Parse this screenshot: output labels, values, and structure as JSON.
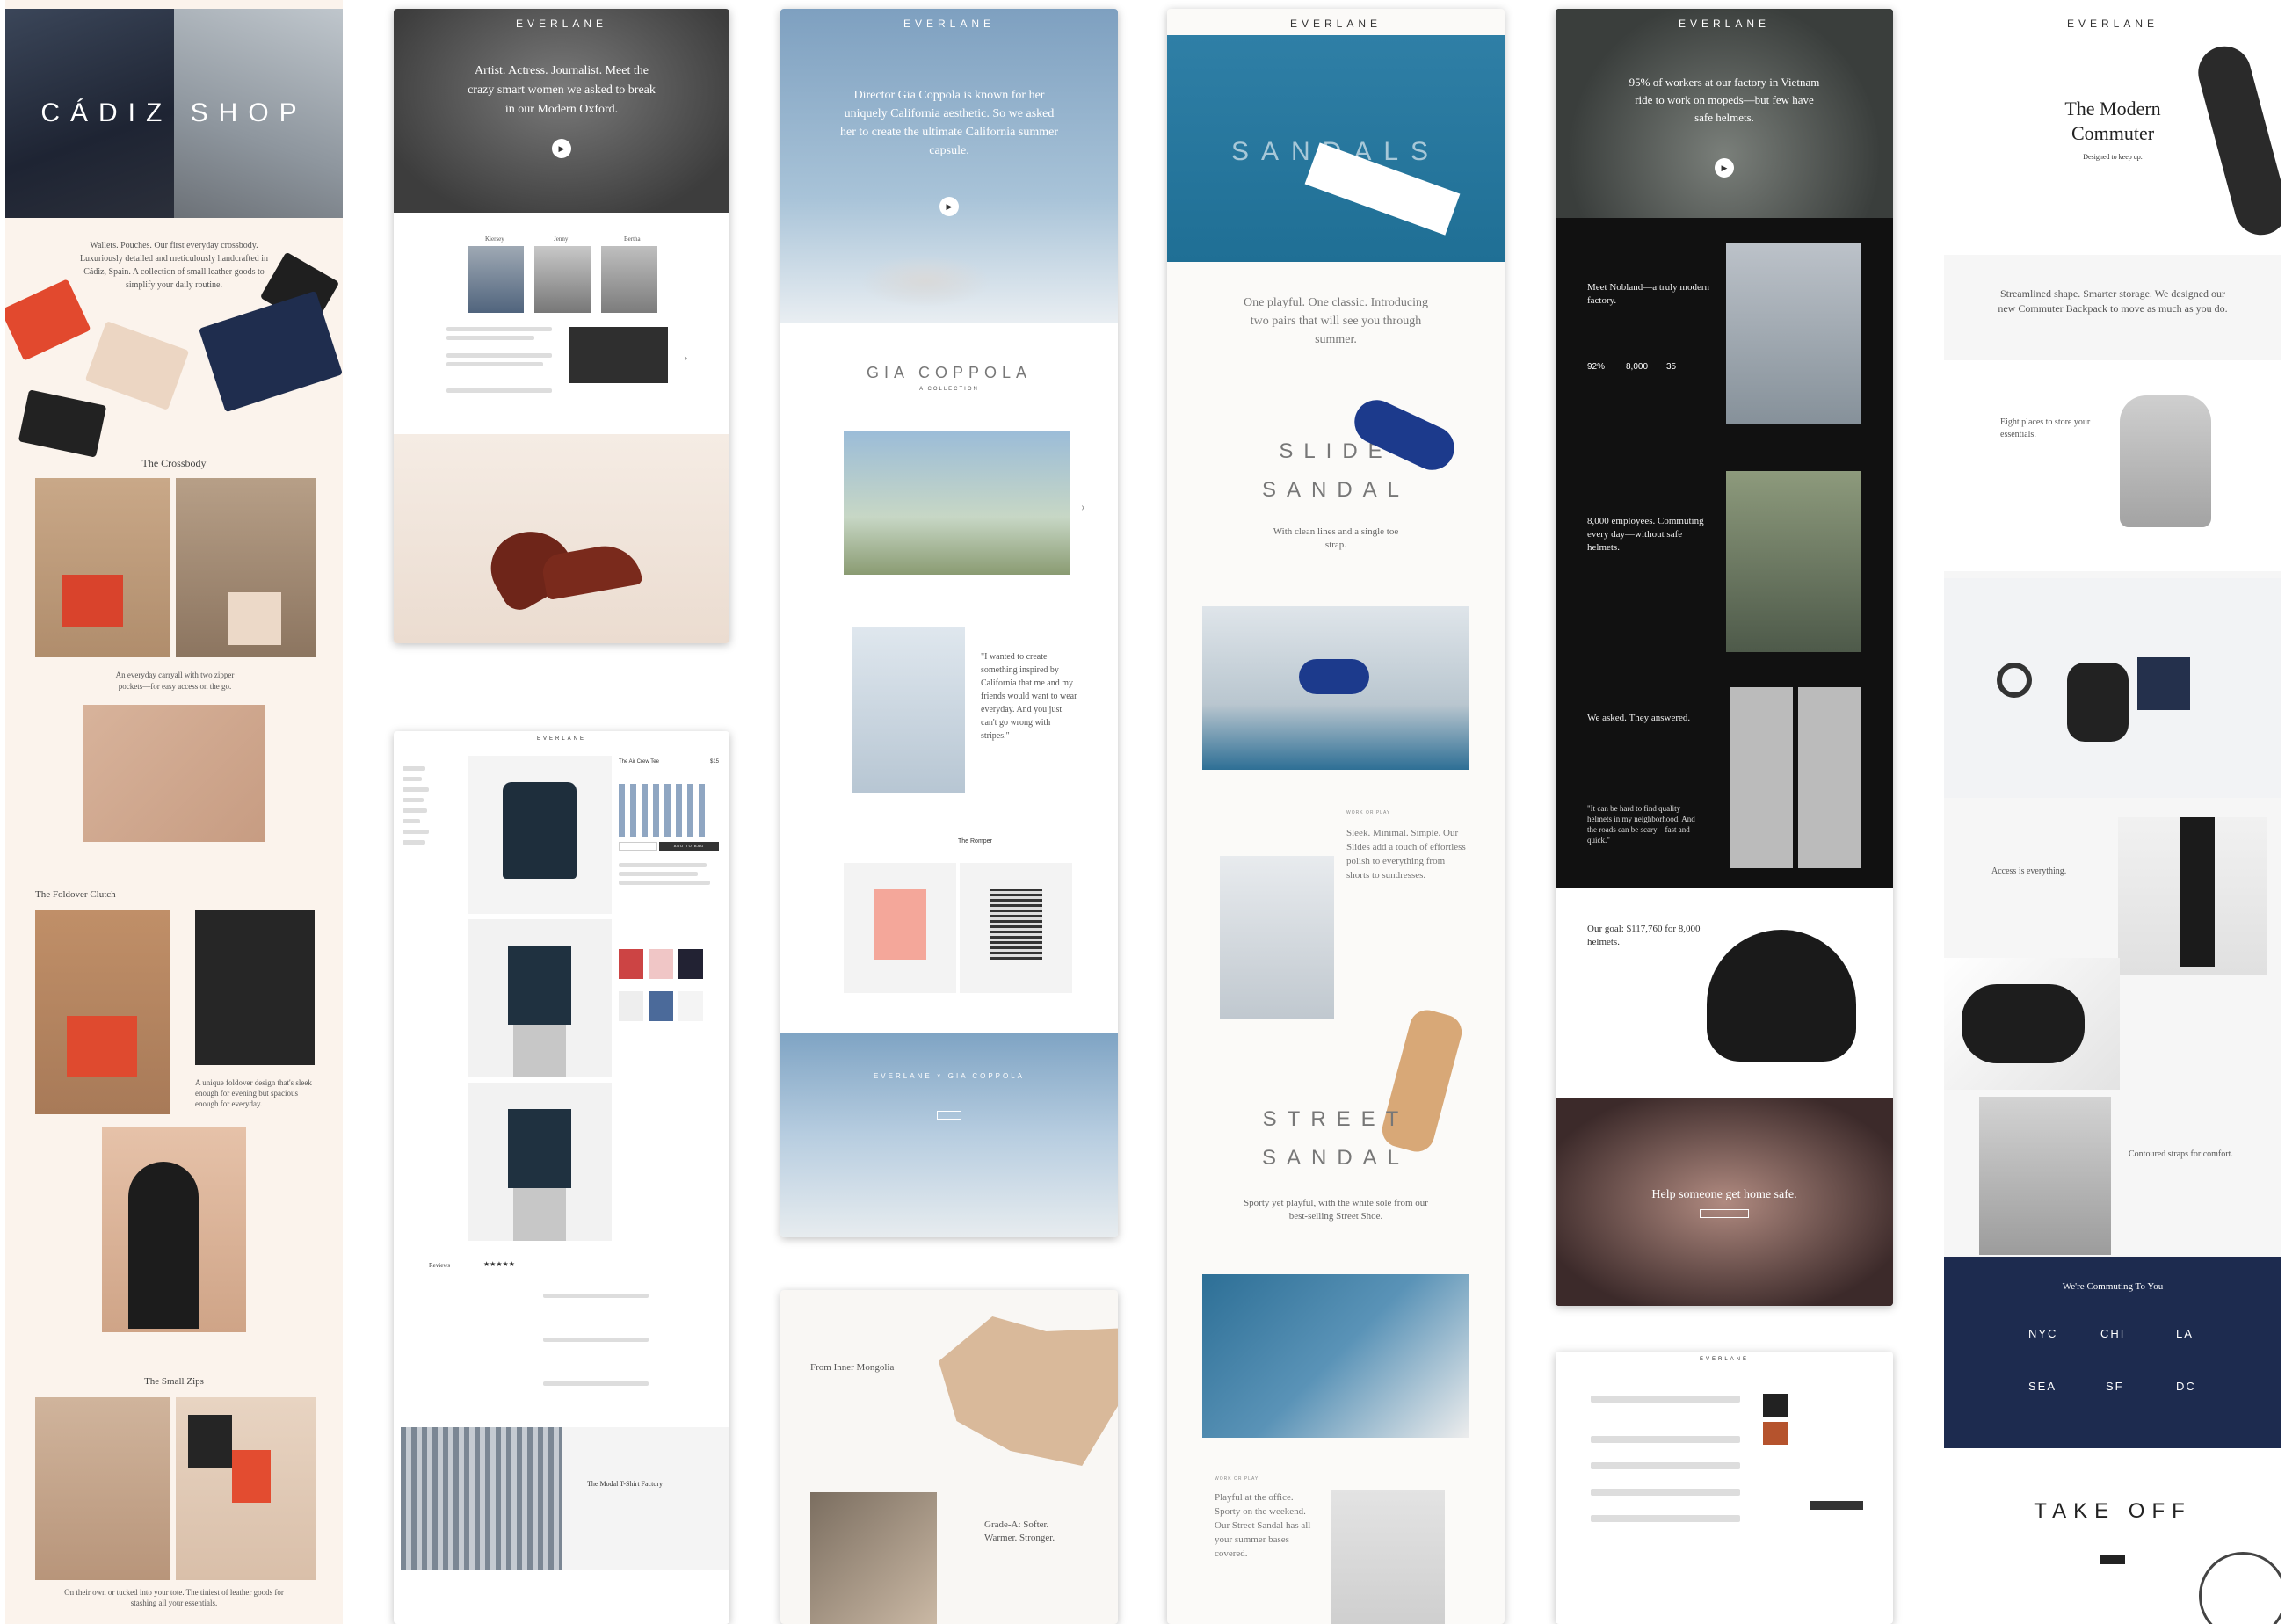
{
  "col1": {
    "hero_title": "CÁDIZ SHOP",
    "intro": "Wallets. Pouches. Our first everyday crossbody. Luxuriously detailed and meticulously handcrafted in Cádiz, Spain. A collection of small leather goods to simplify your daily routine.",
    "crossbody_title": "The Crossbody",
    "crossbody_caption": "An everyday carryall with two zipper pockets—for easy access on the go.",
    "clutch_title": "The Foldover Clutch",
    "clutch_caption": "A unique foldover design that's sleek enough for evening but spacious enough for everyday.",
    "zips_title": "The Small Zips",
    "zips_caption": "On their own or tucked into your tote. The tiniest of leather goods for stashing all your essentials."
  },
  "col2": {
    "logo": "EVERLANE",
    "hero_text": "Artist. Actress. Journalist. Meet the crazy smart women we asked to break in our Modern Oxford.",
    "names": [
      "Kiersey",
      "Jenny",
      "Bertha"
    ],
    "product_title": "The Air Crew Tee",
    "price": "$15",
    "add_to_bag": "ADD TO BAG",
    "reviews_title": "Reviews",
    "factory_title": "The Modal T-Shirt Factory"
  },
  "col3": {
    "logo": "EVERLANE",
    "hero_text": "Director Gia Coppola is known for her uniquely California aesthetic. So we asked her to create the ultimate California summer capsule.",
    "collection_title": "GIA COPPOLA",
    "collection_sub": "A COLLECTION",
    "quote": "\"I wanted to create something inspired by California that me and my friends would want to wear everyday. And you just can't go wrong with stripes.\"",
    "tab_active": "The Romper",
    "banner": "EVERLANE × GIA COPPOLA",
    "mongolia_title": "From Inner Mongolia",
    "grade_text": "Grade-A: Softer. Warmer. Stronger."
  },
  "col4": {
    "logo": "EVERLANE",
    "hero_title": "SANDALS",
    "intro": "One playful. One classic. Introducing two pairs that will see you through summer.",
    "slide_title_1": "SLIDE",
    "slide_title_2": "SANDAL",
    "slide_caption": "With clean lines and a single toe strap.",
    "work_label": "WORK OR PLAY",
    "work_text": "Sleek. Minimal. Simple. Our Slides add a touch of effortless polish to everything from shorts to sundresses.",
    "street_title_1": "STREET",
    "street_title_2": "SANDAL",
    "street_caption": "Sporty yet playful, with the white sole from our best-selling Street Shoe.",
    "office_label": "WORK OR PLAY",
    "office_text": "Playful at the office. Sporty on the weekend. Our Street Sandal has all your summer bases covered."
  },
  "col5": {
    "logo": "EVERLANE",
    "hero_text": "95% of workers at our factory in Vietnam ride to work on mopeds—but few have safe helmets.",
    "nobland_title": "Meet Nobland—a truly modern factory.",
    "stats": [
      "92%",
      "8,000",
      "35"
    ],
    "employees_text": "8,000 employees. Commuting every day—without safe helmets.",
    "asked_text": "We asked. They answered.",
    "quote": "\"It can be hard to find quality helmets in my neighborhood. And the roads can be scary—fast and quick.\"",
    "goal_text": "Our goal: $117,760 for 8,000 helmets.",
    "help_text": "Help someone get home safe.",
    "checkout_logo": "EVERLANE"
  },
  "col6": {
    "logo": "EVERLANE",
    "hero_title": "The Modern Commuter",
    "hero_sub": "Designed to keep up.",
    "intro": "Streamlined shape. Smarter storage. We designed our new Commuter Backpack to move as much as you do.",
    "eight_places": "Eight places to store your essentials.",
    "access_text": "Access is everything.",
    "straps_text": "Contoured straps for comfort.",
    "commuting_title": "We're Commuting To You",
    "cities": [
      "NYC",
      "CHI",
      "LA",
      "SEA",
      "SF",
      "DC"
    ],
    "takeoff": "TAKE OFF"
  }
}
